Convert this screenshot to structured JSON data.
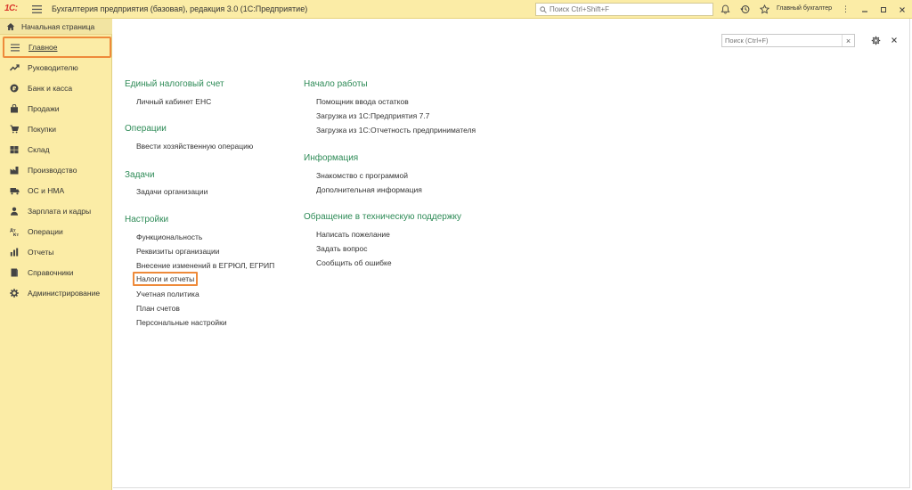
{
  "app": {
    "logo_text": "1С:",
    "title": "Бухгалтерия предприятия (базовая), редакция 3.0  (1С:Предприятие)",
    "search_placeholder": "Поиск Ctrl+Shift+F",
    "username": "Главный бухгалтер",
    "icons": [
      "menu-icon",
      "bell-icon",
      "history-icon",
      "star-icon"
    ]
  },
  "sidebar": {
    "home_label": "Начальная страница",
    "items": [
      {
        "label": "Главное",
        "icon": "menu-icon",
        "active": true
      },
      {
        "label": "Руководителю",
        "icon": "trend-icon"
      },
      {
        "label": "Банк и касса",
        "icon": "cash-icon"
      },
      {
        "label": "Продажи",
        "icon": "bag-icon"
      },
      {
        "label": "Покупки",
        "icon": "cart-icon"
      },
      {
        "label": "Склад",
        "icon": "warehouse-icon"
      },
      {
        "label": "Производство",
        "icon": "factory-icon"
      },
      {
        "label": "ОС и НМА",
        "icon": "truck-icon"
      },
      {
        "label": "Зарплата и кадры",
        "icon": "person-icon"
      },
      {
        "label": "Операции",
        "icon": "operations-icon"
      },
      {
        "label": "Отчеты",
        "icon": "report-icon"
      },
      {
        "label": "Справочники",
        "icon": "book-icon"
      },
      {
        "label": "Администрирование",
        "icon": "gear-icon"
      }
    ]
  },
  "main": {
    "search_placeholder": "Поиск (Ctrl+F)",
    "left_column": [
      {
        "title": "Единый налоговый счет",
        "links": [
          "Личный кабинет ЕНС"
        ]
      },
      {
        "title": "Операции",
        "links": [
          "Ввести хозяйственную операцию"
        ]
      },
      {
        "title": "Задачи",
        "links": [
          "Задачи организации"
        ]
      },
      {
        "title": "Настройки",
        "links": [
          "Функциональность",
          "Реквизиты организации",
          "Внесение изменений в ЕГРЮЛ, ЕГРИП",
          "Налоги и отчеты",
          "Учетная политика",
          "План счетов",
          "Персональные настройки"
        ]
      }
    ],
    "right_column": [
      {
        "title": "Начало работы",
        "links": [
          "Помощник ввода остатков",
          "Загрузка из 1С:Предприятия 7.7",
          "Загрузка из 1С:Отчетность предпринимателя"
        ]
      },
      {
        "title": "Информация",
        "links": [
          "Знакомство с программой",
          "Дополнительная информация"
        ]
      },
      {
        "title": "Обращение в техническую поддержку",
        "links": [
          "Написать пожелание",
          "Задать вопрос",
          "Сообщить об ошибке"
        ]
      }
    ],
    "highlighted_link": "Налоги и отчеты"
  },
  "colors": {
    "panel_bg": "#fbeca6",
    "section_title": "#2e8b57",
    "highlight_border": "#ee8a3a"
  }
}
